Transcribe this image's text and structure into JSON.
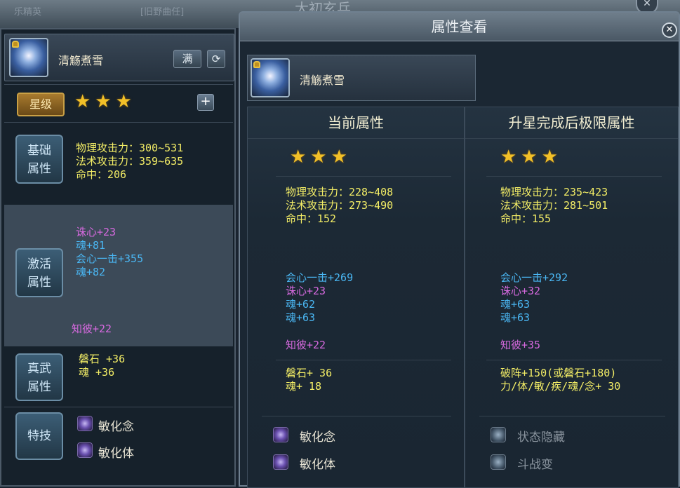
{
  "background": {
    "title": "大初玄兵",
    "ghost_left": "乐精英",
    "ghost_right": "[旧野曲任]",
    "close_label": "✕"
  },
  "left_panel": {
    "item_name": "清觞煮雪",
    "full_button": "满",
    "refresh_button": "⟳",
    "star_label": "星级",
    "stars": "★★★",
    "plus_button": "+",
    "basic": {
      "label_line1": "基础",
      "label_line2": "属性",
      "stats": [
        "物理攻击力：300~531",
        "法术攻击力：359~635",
        "命中：206"
      ]
    },
    "activated": {
      "label_line1": "激活",
      "label_line2": "属性",
      "stats": [
        {
          "text": "诛心+23",
          "color": "#d86ae0"
        },
        {
          "text": "魂+81",
          "color": "#4ab6f2"
        },
        {
          "text": "会心一击+355",
          "color": "#4ab6f2"
        },
        {
          "text": "魂+82",
          "color": "#4ab6f2"
        }
      ],
      "extra": "知彼+22"
    },
    "true_martial": {
      "label_line1": "真武",
      "label_line2": "属性",
      "stats": [
        "磐石 +36",
        "魂 +36"
      ]
    },
    "skills": {
      "label": "特技",
      "items": [
        "敏化念",
        "敏化体"
      ]
    }
  },
  "right_panel": {
    "title": "属性查看",
    "close_label": "✕",
    "item_name": "清觞煮雪",
    "current": {
      "header": "当前属性",
      "stars": "★★★",
      "basic": [
        "物理攻击力：228~408",
        "法术攻击力：273~490",
        "命中：152"
      ],
      "activated": [
        {
          "text": "会心一击+269",
          "color": "#4ab6f2"
        },
        {
          "text": "诛心+23",
          "color": "#d86ae0"
        },
        {
          "text": "魂+62",
          "color": "#4ab6f2"
        },
        {
          "text": "魂+63",
          "color": "#4ab6f2"
        }
      ],
      "extra": "知彼+22",
      "true_martial": [
        "磐石+ 36",
        "魂+ 18"
      ],
      "skills": [
        "敏化念",
        "敏化体"
      ]
    },
    "max": {
      "header": "升星完成后极限属性",
      "stars": "★★★",
      "basic": [
        "物理攻击力：235~423",
        "法术攻击力：281~501",
        "命中：155"
      ],
      "activated": [
        {
          "text": "会心一击+292",
          "color": "#4ab6f2"
        },
        {
          "text": "诛心+32",
          "color": "#d86ae0"
        },
        {
          "text": "魂+63",
          "color": "#4ab6f2"
        },
        {
          "text": "魂+63",
          "color": "#4ab6f2"
        }
      ],
      "extra": "知彼+35",
      "true_martial": [
        "破阵+150(或磐石+180)",
        "力/体/敏/疾/魂/念+ 30"
      ],
      "skills": [
        "状态隐藏",
        "斗战变"
      ]
    }
  }
}
